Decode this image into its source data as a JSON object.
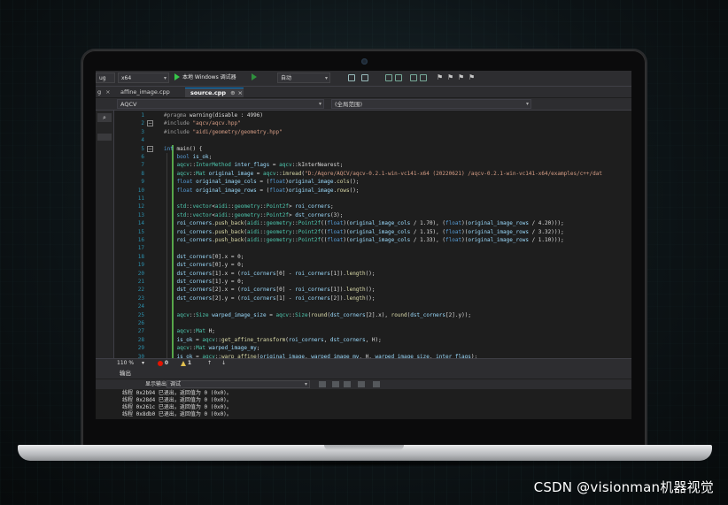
{
  "watermark": "CSDN @visionman机器视觉",
  "toolbar": {
    "left_dd": "ug",
    "platform": "x64",
    "run_target": "本地 Windows 调试器",
    "mode": "自动"
  },
  "tabs": [
    {
      "label": "affine_image.cpp",
      "active": false
    },
    {
      "label": "source.cpp",
      "active": true
    }
  ],
  "tab_pin": "⊕",
  "tab_close": "×",
  "left_tab_fragment": "g",
  "nav": {
    "project": "AQCV",
    "scope": "(全局范围)"
  },
  "code_lines": [
    {
      "n": "1",
      "t": "#pragma warning(disable : 4996)"
    },
    {
      "n": "2",
      "t": "#include \"aqcv/aqcv.hpp\""
    },
    {
      "n": "3",
      "t": "#include \"aidi/geometry/geometry.hpp\""
    },
    {
      "n": "4",
      "t": ""
    },
    {
      "n": "5",
      "t": "int main() {"
    },
    {
      "n": "6",
      "t": "    bool is_ok;"
    },
    {
      "n": "7",
      "t": "    aqcv::InterMethod inter_flags = aqcv::kInterNearest;"
    },
    {
      "n": "8",
      "t": "    aqcv::Mat original_image = aqcv::imread(\"D:/Aqore/AQCV/aqcv-0.2.1-win-vc141-x64 (20220621) /aqcv-0.2.1-win-vc141-x64/examples/c++/dat"
    },
    {
      "n": "9",
      "t": "    float original_image_cols = (float)original_image.cols();"
    },
    {
      "n": "10",
      "t": "    float original_image_rows = (float)original_image.rows();"
    },
    {
      "n": "11",
      "t": ""
    },
    {
      "n": "12",
      "t": "    std::vector<aidi::geometry::Point2f> roi_corners;"
    },
    {
      "n": "13",
      "t": "    std::vector<aidi::geometry::Point2f> dst_corners(3);"
    },
    {
      "n": "14",
      "t": "    roi_corners.push_back(aidi::geometry::Point2f((float)(original_image_cols / 1.70), (float)(original_image_rows / 4.20)));"
    },
    {
      "n": "15",
      "t": "    roi_corners.push_back(aidi::geometry::Point2f((float)(original_image_cols / 1.15), (float)(original_image_rows / 3.32)));"
    },
    {
      "n": "16",
      "t": "    roi_corners.push_back(aidi::geometry::Point2f((float)(original_image_cols / 1.33), (float)(original_image_rows / 1.10)));"
    },
    {
      "n": "17",
      "t": ""
    },
    {
      "n": "18",
      "t": "    dst_corners[0].x = 0;"
    },
    {
      "n": "19",
      "t": "    dst_corners[0].y = 0;"
    },
    {
      "n": "20",
      "t": "    dst_corners[1].x = (roi_corners[0] - roi_corners[1]).length();"
    },
    {
      "n": "21",
      "t": "    dst_corners[1].y = 0;"
    },
    {
      "n": "22",
      "t": "    dst_corners[2].x = (roi_corners[0] - roi_corners[1]).length();"
    },
    {
      "n": "23",
      "t": "    dst_corners[2].y = (roi_corners[1] - roi_corners[2]).length();"
    },
    {
      "n": "24",
      "t": ""
    },
    {
      "n": "25",
      "t": "    aqcv::Size warped_image_size = aqcv::Size(round(dst_corners[2].x), round(dst_corners[2].y));"
    },
    {
      "n": "26",
      "t": ""
    },
    {
      "n": "27",
      "t": "    aqcv::Mat H;"
    },
    {
      "n": "28",
      "t": "    is_ok = aqcv::get_affine_transform(roi_corners, dst_corners, H);"
    },
    {
      "n": "29",
      "t": "    aqcv::Mat warped_image_my;"
    },
    {
      "n": "30",
      "t": "    is_ok = aqcv::warp_affine(original_image, warped_image_my, H, warped_image_size, inter_flags);"
    }
  ],
  "status": {
    "zoom": "110 %",
    "errors": "0",
    "warnings": "1"
  },
  "output": {
    "title": "输出",
    "show_from_label": "显示输出来源(S):",
    "source": "调试",
    "lines": [
      "线程 0x2b94 已退出，返回值为 0 (0x0)。",
      "线程 0x28d4 已退出，返回值为 0 (0x0)。",
      "线程 0x261c 已退出，返回值为 0 (0x0)。",
      "线程 0x8db0 已退出，返回值为 0 (0x0)。"
    ]
  },
  "colors": {
    "keyword": "#569cd6",
    "string": "#d69d85",
    "type": "#4ec9b0",
    "line_number": "#2b91af",
    "editor_bg": "#1e1e1e"
  }
}
